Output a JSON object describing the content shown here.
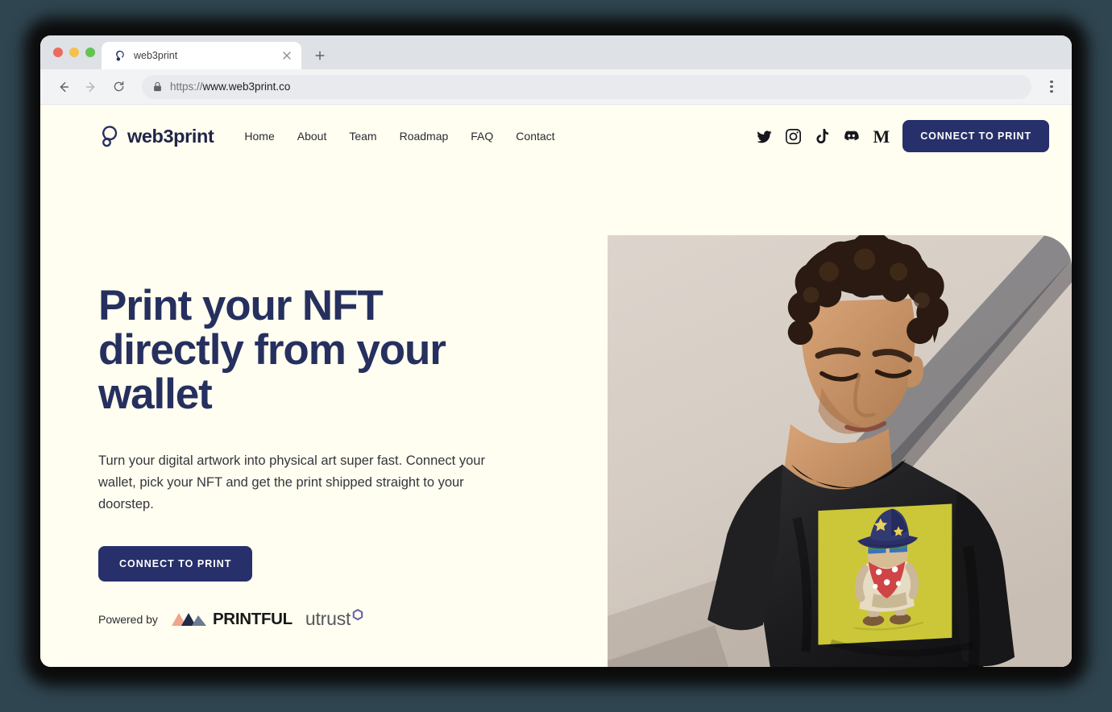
{
  "browser": {
    "tab": {
      "title": "web3print",
      "favicon_icon": "web3print-logo-icon",
      "close_icon": "close-icon"
    },
    "newtab_icon": "plus-icon",
    "back_icon": "back-arrow-icon",
    "forward_icon": "forward-arrow-icon",
    "reload_icon": "reload-icon",
    "lock_icon": "lock-icon",
    "url_scheme": "https://",
    "url_host": "www.web3print.co",
    "menu_icon": "three-dot-menu-icon"
  },
  "site": {
    "brand": {
      "name": "web3print",
      "logo_icon": "web3print-logo-icon"
    },
    "nav": [
      {
        "label": "Home"
      },
      {
        "label": "About"
      },
      {
        "label": "Team"
      },
      {
        "label": "Roadmap"
      },
      {
        "label": "FAQ"
      },
      {
        "label": "Contact"
      }
    ],
    "socials": [
      {
        "name": "twitter-icon"
      },
      {
        "name": "instagram-icon"
      },
      {
        "name": "tiktok-icon"
      },
      {
        "name": "discord-icon"
      },
      {
        "name": "medium-icon",
        "glyph": "M"
      }
    ],
    "header_cta": "CONNECT TO PRINT",
    "hero": {
      "title": "Print your NFT directly from your wallet",
      "subtitle": "Turn your digital artwork into physical art super fast. Connect your wallet, pick your NFT and get the print shipped straight to your doorstep.",
      "cta": "CONNECT TO PRINT",
      "photo_alt": "Man with curly hair wearing a black t-shirt printed with a yellow NFT wizard artwork"
    },
    "powered": {
      "label": "Powered by",
      "partners": [
        {
          "name": "printful",
          "wordmark": "PRINTFUL"
        },
        {
          "name": "utrust",
          "wordmark": "utrust"
        }
      ]
    }
  },
  "colors": {
    "page_background": "#fffef0",
    "brand_navy": "#26305f",
    "button_navy": "#27306b",
    "text_dark": "#2b2b33",
    "utrust_purple": "#6b5fad",
    "backdrop": "#2f4550"
  }
}
